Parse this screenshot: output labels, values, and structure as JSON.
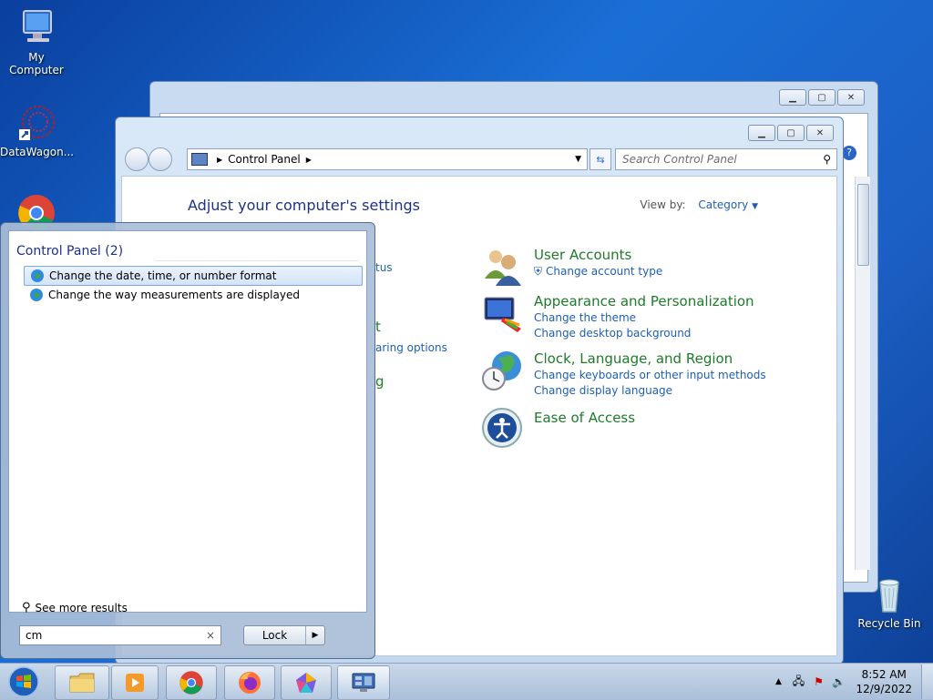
{
  "desktop": {
    "icons": [
      {
        "label": "My Computer"
      },
      {
        "label": "DataWagon..."
      },
      {
        "label": "Recycle Bin"
      }
    ]
  },
  "window": {
    "address": {
      "root": "Control Panel"
    },
    "search_placeholder": "Search Control Panel",
    "heading": "Adjust your computer's settings",
    "view_by_label": "View by:",
    "view_by_value": "Category",
    "partial_links": [
      "tus",
      "t",
      "aring options",
      "g"
    ],
    "categories": [
      {
        "title": "User Accounts",
        "links": [
          "Change account type"
        ],
        "icon": "user-accounts-icon"
      },
      {
        "title": "Appearance and Personalization",
        "links": [
          "Change the theme",
          "Change desktop background"
        ],
        "icon": "appearance-icon"
      },
      {
        "title": "Clock, Language, and Region",
        "links": [
          "Change keyboards or other input methods",
          "Change display language"
        ],
        "icon": "clock-globe-icon"
      },
      {
        "title": "Ease of Access",
        "links": [],
        "icon": "ease-of-access-icon"
      }
    ]
  },
  "start_menu": {
    "group_title": "Control Panel (2)",
    "results": [
      {
        "label": "Change the date, time, or number format",
        "selected": true
      },
      {
        "label": "Change the way measurements are displayed",
        "selected": false
      }
    ],
    "see_more": "See more results",
    "search_value": "cm",
    "lock_label": "Lock"
  },
  "taskbar": {
    "time": "8:52 AM",
    "date": "12/9/2022"
  }
}
